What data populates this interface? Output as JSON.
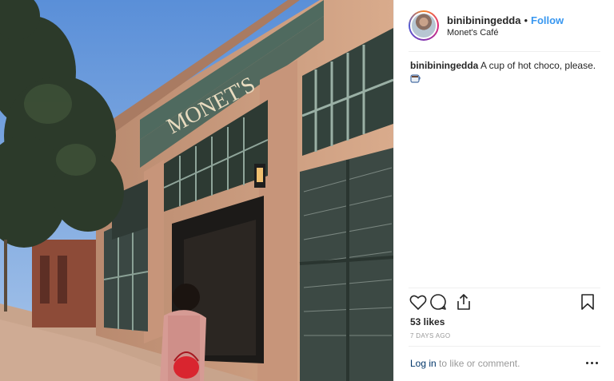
{
  "post": {
    "username": "binibiningedda",
    "follow_label": "Follow",
    "separator": "•",
    "location": "Monet's Café",
    "caption_username": "binibiningedda",
    "caption_text": "A cup of hot choco, please.",
    "caption_emoji": "coffee-cup-icon",
    "likes": "53 likes",
    "timestamp": "7 DAYS AGO",
    "login_link": "Log in",
    "login_suffix": " to like or comment."
  },
  "photo": {
    "sign_text": "MONET'S"
  },
  "colors": {
    "follow": "#3897f0",
    "muted": "#999999",
    "link": "#003569"
  },
  "icons": [
    "heart-icon",
    "comment-icon",
    "share-icon",
    "bookmark-icon",
    "more-options-icon"
  ]
}
